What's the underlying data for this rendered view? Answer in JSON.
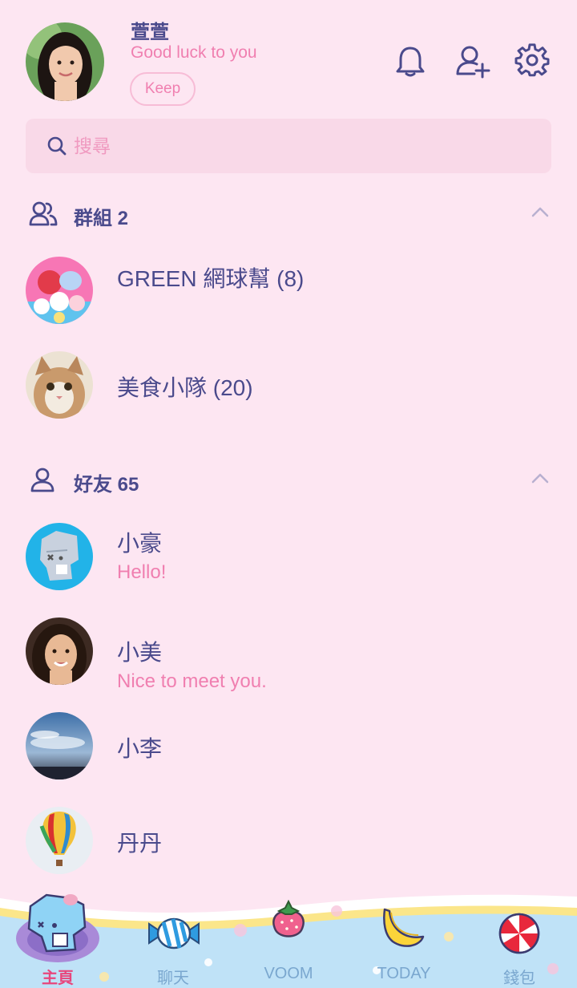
{
  "profile": {
    "name": "萱萱",
    "status": "Good luck to you",
    "keep_label": "Keep"
  },
  "search": {
    "placeholder": "搜尋"
  },
  "groups": {
    "title": "群組 2",
    "items": [
      {
        "name": "GREEN 網球幫 (8)"
      },
      {
        "name": "美食小隊 (20)"
      }
    ]
  },
  "friends": {
    "title": "好友 65",
    "items": [
      {
        "name": "小豪",
        "message": "Hello!"
      },
      {
        "name": "小美",
        "message": "Nice to meet you."
      },
      {
        "name": "小李",
        "message": ""
      },
      {
        "name": "丹丹",
        "message": ""
      }
    ]
  },
  "nav": {
    "items": [
      {
        "label": "主頁",
        "icon": "mascot-icon",
        "active": true
      },
      {
        "label": "聊天",
        "icon": "candy-icon"
      },
      {
        "label": "VOOM",
        "icon": "strawberry-icon"
      },
      {
        "label": "TODAY",
        "icon": "banana-icon"
      },
      {
        "label": "錢包",
        "icon": "peppermint-icon"
      }
    ]
  },
  "colors": {
    "background": "#fde6f2",
    "text_primary": "#4a4a8c",
    "accent_pink": "#f07fb0",
    "nav_active": "#e8467c",
    "nav_inactive": "#7aa7cf"
  }
}
